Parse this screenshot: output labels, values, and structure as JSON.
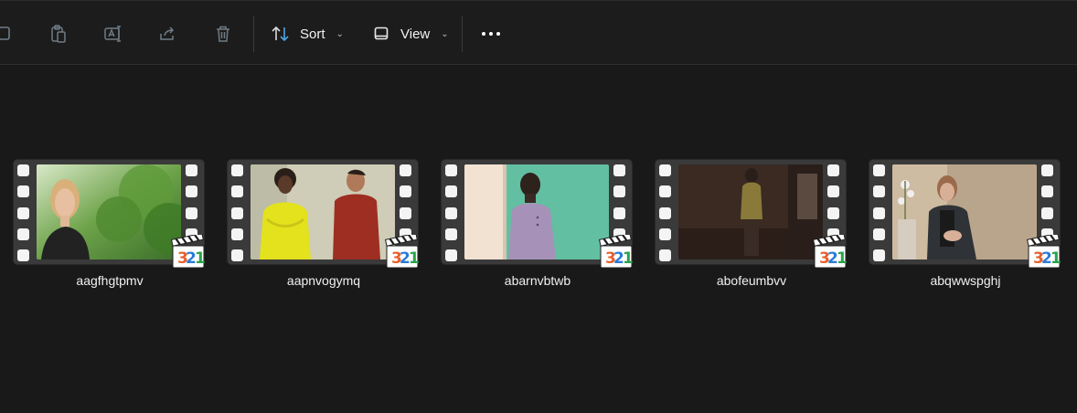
{
  "toolbar": {
    "sort_label": "Sort",
    "view_label": "View",
    "icons": [
      "copy-icon",
      "paste-icon",
      "rename-icon",
      "share-icon",
      "delete-icon",
      "sort-icon",
      "view-icon",
      "more-icon"
    ]
  },
  "files": [
    {
      "name": "aagfhgtpmv",
      "scene": "man outdoors with long blond hair in front of green foliage"
    },
    {
      "name": "aapnvogymq",
      "scene": "woman in yellow top and man in red sweater indoors"
    },
    {
      "name": "abarnvbtwb",
      "scene": "woman in purple top against teal wall"
    },
    {
      "name": "abofeumbvv",
      "scene": "dim room with person in yellow standing"
    },
    {
      "name": "abqwwspghj",
      "scene": "woman seated in dark jacket near white flowers"
    }
  ],
  "badge": {
    "text": "321",
    "digits": [
      "3",
      "2",
      "1"
    ],
    "colors": [
      "#e8602c",
      "#2a7bd6",
      "#2aa34a"
    ]
  },
  "colors": {
    "background": "#191919",
    "toolbar": "#1c1c1c",
    "accent_sort_arrow": "#4ca3e0"
  }
}
